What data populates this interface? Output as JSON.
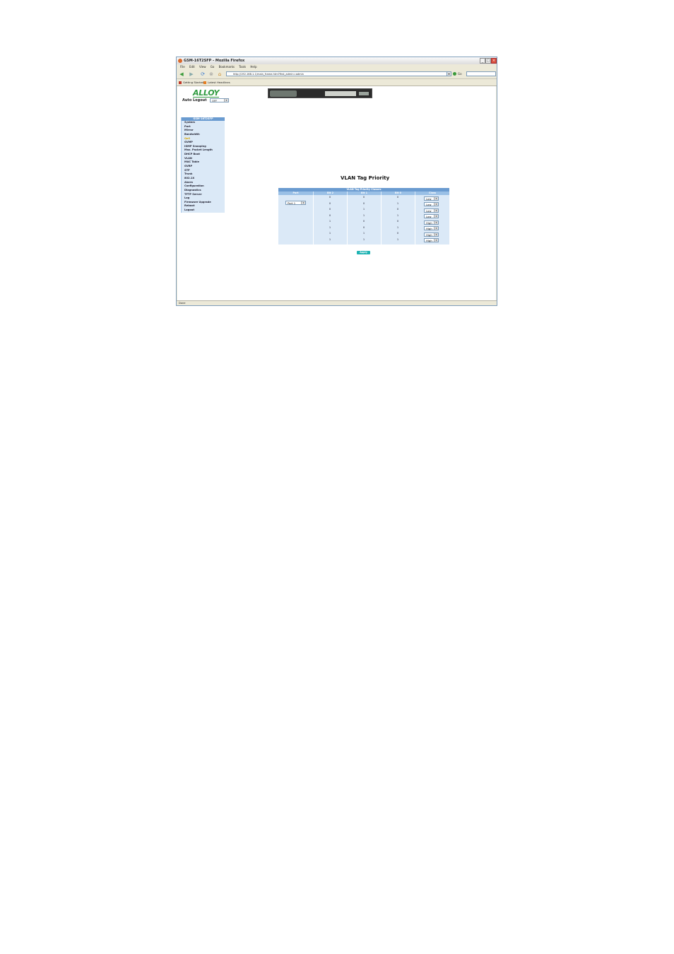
{
  "window": {
    "title": "GSM-16T2SFP - Mozilla Firefox",
    "controls": [
      "_",
      "□",
      "×"
    ]
  },
  "menu": [
    "File",
    "Edit",
    "View",
    "Go",
    "Bookmarks",
    "Tools",
    "Help"
  ],
  "toolbar": {
    "address": "http://192.168.1.1/main_frame.htm?first_admin=admin",
    "go_label": "Go"
  },
  "bookmarks": [
    "Getting Started",
    "Latest Headlines"
  ],
  "status": "Done",
  "page": {
    "logo": "ALLOY",
    "auto_logout_label": "Auto Logout",
    "auto_logout_value": "OFF",
    "title": "VLAN Tag Priority",
    "apply_label": "Apply"
  },
  "sidebar": {
    "header": "GSM-16T2SFP",
    "items": [
      "System",
      "Port",
      "Mirror",
      "Bandwidth",
      "QoS",
      "GVMP",
      "IGMP Snooping",
      "Max. Packet Length",
      "DHCP Boot",
      "VLAN",
      "MAC Table",
      "GVRP",
      "STP",
      "Trunk",
      "802.1X",
      "Alarm",
      "Configuration",
      "Diagnostics",
      "TFTP Server",
      "Log",
      "Firmware Upgrade",
      "Reboot",
      "Logout"
    ],
    "active_index": 4
  },
  "priority_table": {
    "caption": "VLAN Tag Priority Classes",
    "headers": [
      "Port",
      "Bit 2",
      "Bit 1",
      "Bit 0",
      "Class"
    ],
    "port_value": "Port 1",
    "rows": [
      [
        "0",
        "0",
        "0",
        "Low"
      ],
      [
        "0",
        "0",
        "1",
        "Low"
      ],
      [
        "0",
        "1",
        "0",
        "Low"
      ],
      [
        "0",
        "1",
        "1",
        "Low"
      ],
      [
        "1",
        "0",
        "0",
        "High"
      ],
      [
        "1",
        "0",
        "1",
        "High"
      ],
      [
        "1",
        "1",
        "0",
        "High"
      ],
      [
        "1",
        "1",
        "1",
        "High"
      ]
    ]
  }
}
